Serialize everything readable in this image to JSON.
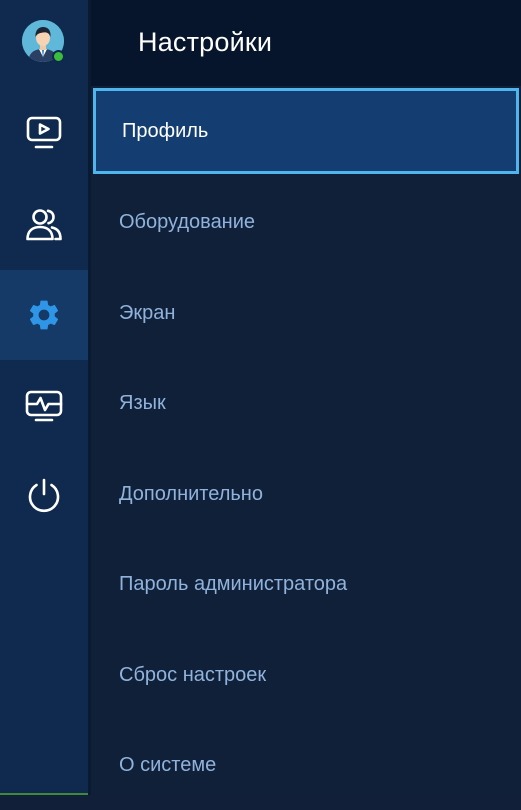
{
  "header": {
    "title": "Настройки"
  },
  "rail": {
    "avatar_status": "online",
    "items": [
      {
        "icon": "tv-play-icon",
        "active": false
      },
      {
        "icon": "users-icon",
        "active": false
      },
      {
        "icon": "gear-icon",
        "active": true
      },
      {
        "icon": "monitor-pulse-icon",
        "active": false
      },
      {
        "icon": "power-icon",
        "active": false
      }
    ]
  },
  "menu": {
    "items": [
      {
        "label": "Профиль",
        "selected": true
      },
      {
        "label": "Оборудование",
        "selected": false
      },
      {
        "label": "Экран",
        "selected": false
      },
      {
        "label": "Язык",
        "selected": false
      },
      {
        "label": "Дополнительно",
        "selected": false
      },
      {
        "label": "Пароль администратора",
        "selected": false
      },
      {
        "label": "Сброс настроек",
        "selected": false
      },
      {
        "label": "О системе",
        "selected": false
      }
    ]
  },
  "colors": {
    "accent": "#4eb5ee",
    "rail_bg": "#0f2a4e",
    "menu_bg": "#112039",
    "header_bg": "#06152b",
    "selected_bg": "#143e71",
    "menu_text": "#8fb3dc",
    "status_online": "#3bbf3b"
  }
}
